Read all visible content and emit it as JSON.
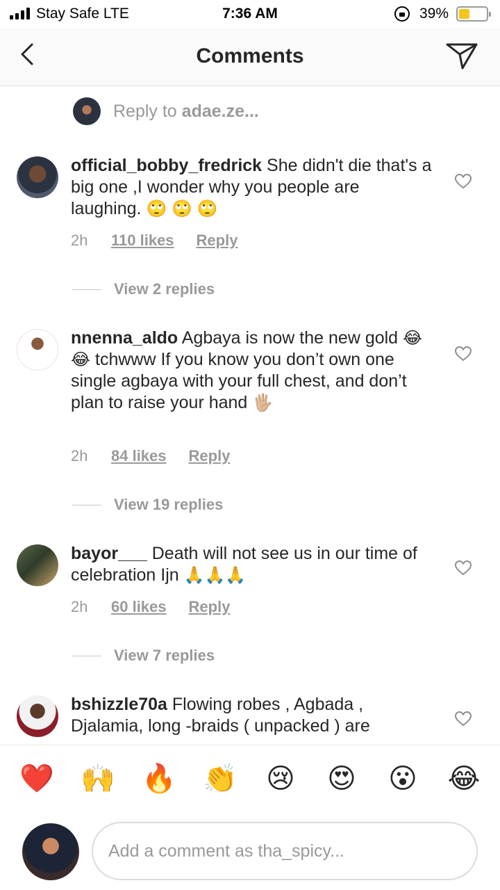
{
  "status_bar": {
    "carrier": "Stay Safe  LTE",
    "time": "7:36 AM",
    "battery_percent": "39%",
    "battery_level": 0.39
  },
  "header": {
    "title": "Comments",
    "back_icon": "chevron-left-icon",
    "send_icon": "paper-plane-icon"
  },
  "reply_context": {
    "prefix": "Reply to ",
    "username": "adae.ze..."
  },
  "comments": [
    {
      "username": "official_bobby_fredrick",
      "text": "She didn't die that's a big one ,I wonder why you people are laughing.",
      "emojis": "🙄 🙄 🙄",
      "time": "2h",
      "likes": "110 likes",
      "reply_label": "Reply",
      "view_replies": "View 2 replies"
    },
    {
      "username": "nnenna_aldo",
      "text": "Agbaya is now the new gold",
      "emojis_1": "😂 😂",
      "text_2": "tchwww If you know you don’t own one single agbaya with your full chest, and don’t plan to raise your hand",
      "emojis_2": "🖐🏼",
      "time": "2h",
      "likes": "84 likes",
      "reply_label": "Reply",
      "view_replies": "View 19 replies"
    },
    {
      "username": "bayor___",
      "text": "Death will not see us in our time of celebration Ijn",
      "emojis": "🙏🙏🙏",
      "time": "2h",
      "likes": "60 likes",
      "reply_label": "Reply",
      "view_replies": "View 7 replies"
    },
    {
      "username": "bshizzle70a",
      "text": "Flowing robes , Agbada , Djalamia, long -braids ( unpacked ) are"
    }
  ],
  "emoji_bar": [
    "❤️",
    "🙌",
    "🔥",
    "👏",
    "😢",
    "😍",
    "😮",
    "😂"
  ],
  "composer": {
    "placeholder": "Add a comment as tha_spicy..."
  }
}
